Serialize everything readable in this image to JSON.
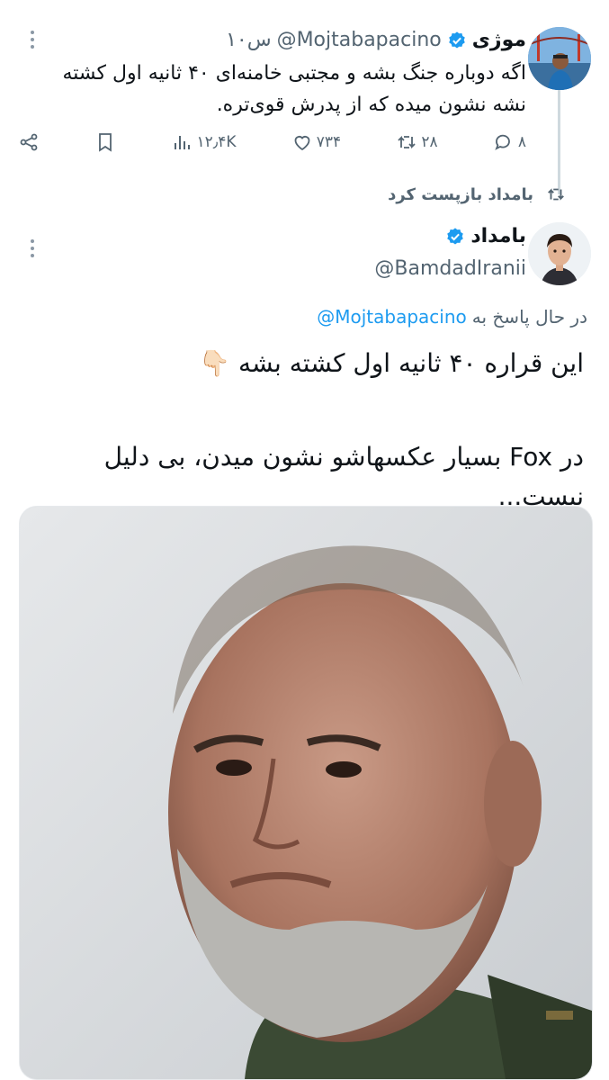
{
  "colors": {
    "accent": "#1d9bf0",
    "muted": "#536471",
    "text": "#0f1419",
    "line": "#cfd9de"
  },
  "tweet1": {
    "author_name": "موژی",
    "handle": "@Mojtabapacino",
    "time": "۱۰س",
    "text_line1": "اگه دوباره جنگ بشه و مجتبی خامنه‌ای ۴۰ ثانیه اول کشته",
    "text_line2": "نشه نشون میده که از پدرش قوی‌تره.",
    "replies": "۸",
    "retweets": "۲۸",
    "likes": "۷۳۴",
    "views": "۱۲٫۴K"
  },
  "retweet_banner": {
    "text": "بامداد بازپست کرد"
  },
  "tweet2": {
    "author_name": "بامداد",
    "handle": "@BamdadIranii",
    "reply_prefix": "در حال پاسخ به",
    "reply_handle": "@Mojtabapacino",
    "line1": "این قراره ۴۰ ثانیه اول کشته بشه 👇🏻",
    "line2": "در Fox بسیار عکسهاشو نشون میدن، بی دلیل نیست..."
  },
  "icons": [
    "verified-icon",
    "more-icon",
    "reply-icon",
    "retweet-icon",
    "like-icon",
    "views-icon",
    "bookmark-icon",
    "share-icon"
  ]
}
